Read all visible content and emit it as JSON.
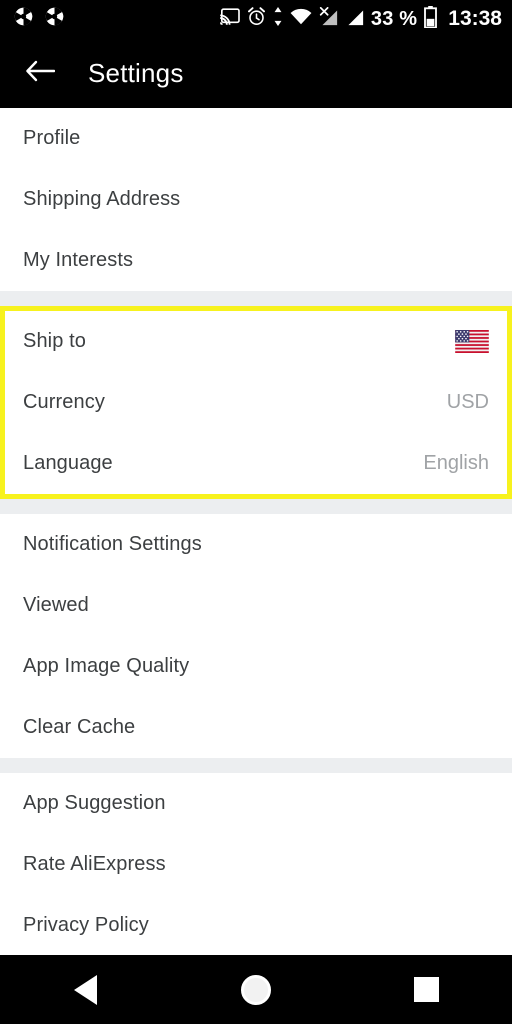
{
  "statusbar": {
    "left_icons": [
      "aperture-icon",
      "aperture-icon"
    ],
    "right_icons": [
      "cast-icon",
      "alarm-clock-icon",
      "data-transfer-icon",
      "wifi-icon",
      "no-sim-signal-icon",
      "cellular-signal-icon"
    ],
    "battery_percent": "33 %",
    "battery_icon": "battery-icon",
    "clock": "13:38"
  },
  "appbar": {
    "back_icon": "back-arrow-icon",
    "title": "Settings"
  },
  "groups": [
    {
      "highlighted": false,
      "rows": [
        {
          "label": "Profile",
          "value": "",
          "icon": ""
        },
        {
          "label": "Shipping Address",
          "value": "",
          "icon": ""
        },
        {
          "label": "My Interests",
          "value": "",
          "icon": ""
        }
      ]
    },
    {
      "highlighted": true,
      "highlight_color": "#f7f21e",
      "rows": [
        {
          "label": "Ship to",
          "value": "",
          "icon": "us-flag-icon"
        },
        {
          "label": "Currency",
          "value": "USD",
          "icon": ""
        },
        {
          "label": "Language",
          "value": "English",
          "icon": ""
        }
      ]
    },
    {
      "highlighted": false,
      "rows": [
        {
          "label": "Notification Settings",
          "value": "",
          "icon": ""
        },
        {
          "label": "Viewed",
          "value": "",
          "icon": ""
        },
        {
          "label": "App Image Quality",
          "value": "",
          "icon": ""
        },
        {
          "label": "Clear Cache",
          "value": "",
          "icon": ""
        }
      ]
    },
    {
      "highlighted": false,
      "rows": [
        {
          "label": "App Suggestion",
          "value": "",
          "icon": ""
        },
        {
          "label": "Rate AliExpress",
          "value": "",
          "icon": ""
        },
        {
          "label": "Privacy Policy",
          "value": "",
          "icon": ""
        }
      ]
    }
  ],
  "navbar": {
    "back_icon": "nav-back-triangle-icon",
    "home_icon": "nav-home-circle-icon",
    "recents_icon": "nav-recents-square-icon"
  },
  "colors": {
    "bar_background": "#000000",
    "page_background": "#ffffff",
    "separator": "#eceef0",
    "label_text": "#3c3f41",
    "value_text": "#a0a3a6",
    "highlight": "#f7f21e"
  }
}
